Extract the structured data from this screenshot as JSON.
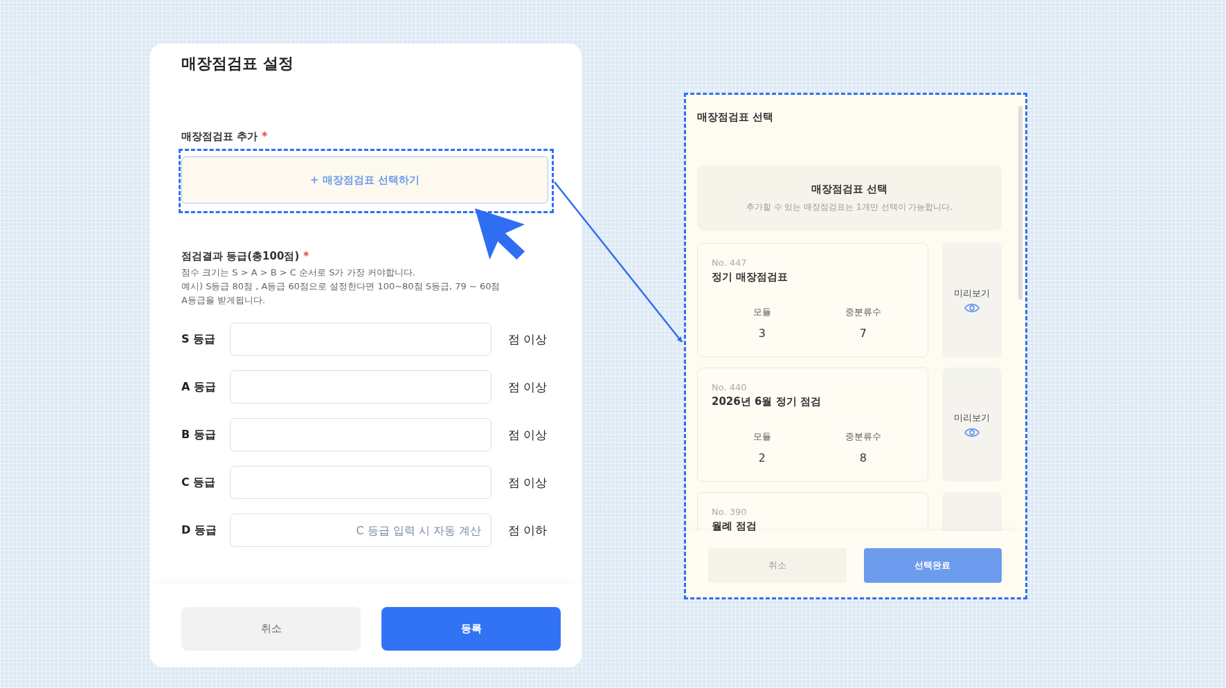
{
  "form": {
    "title": "매장점검표 설정",
    "checklist_label": "매장점검표 추가",
    "checklist_required_mark": "*",
    "select_button": "+ 매장점검표 선택하기",
    "grade_label": "점검결과 등급(총100점)",
    "grade_required_mark": "*",
    "help_lines": [
      "점수 크기는 S > A > B > C 순서로 S가 가장 커야합니다.",
      "예시) S등급 80점 , A등급 60점으로 설정한다면 100~80점 S등급, 79 ~ 60점",
      "A등급을 받게됩니다."
    ],
    "grades": [
      {
        "label": "S 등급",
        "suffix": "점 이상"
      },
      {
        "label": "A 등급",
        "suffix": "점 이상"
      },
      {
        "label": "B 등급",
        "suffix": "점 이상"
      },
      {
        "label": "C 등급",
        "suffix": "점 이상"
      },
      {
        "label": "D 등급",
        "placeholder": "C 등급 입력 시 자동 계산",
        "suffix": "점 이하"
      }
    ],
    "buttons": [
      {
        "label": "취소",
        "kind": "secondary"
      },
      {
        "label": "등록",
        "kind": "primary"
      }
    ]
  },
  "picker": {
    "title": "매장점검표 선택",
    "info_title": "매장점검표 선택",
    "info_note": "추가할 수 있는 매장점검표는 1개만 선택이 가능합니다.",
    "items": [
      {
        "no": "No. 447",
        "name": "정기 매장점검표",
        "stats": [
          {
            "label": "모듈",
            "value": "3"
          },
          {
            "label": "중분류수",
            "value": "7"
          }
        ],
        "preview": "미리보기"
      },
      {
        "no": "No. 440",
        "name": "2026년 6월 정기 점검",
        "stats": [
          {
            "label": "모듈",
            "value": "2"
          },
          {
            "label": "중분류수",
            "value": "8"
          }
        ],
        "preview": "미리보기"
      },
      {
        "no": "No. 390",
        "name": "월례 점검"
      }
    ],
    "buttons": [
      {
        "label": "취소",
        "kind": "secondary",
        "disabled": false
      },
      {
        "label": "선택완료",
        "kind": "primary",
        "disabled": true
      }
    ]
  }
}
